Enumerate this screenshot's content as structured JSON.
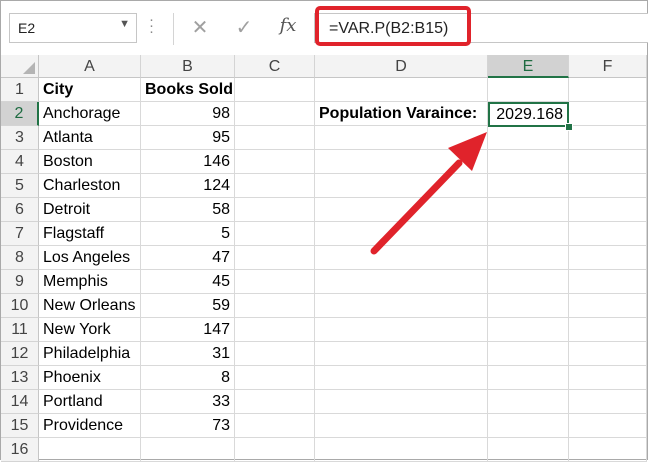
{
  "name_box": {
    "value": "E2"
  },
  "formula_bar": {
    "cancel_glyph": "✕",
    "enter_glyph": "✓",
    "fx_label": "fx",
    "formula": "=VAR.P(B2:B15)"
  },
  "columns": [
    "A",
    "B",
    "C",
    "D",
    "E",
    "F"
  ],
  "rows": [
    "1",
    "2",
    "3",
    "4",
    "5",
    "6",
    "7",
    "8",
    "9",
    "10",
    "11",
    "12",
    "13",
    "14",
    "15",
    "16"
  ],
  "headers": {
    "city": "City",
    "books_sold": "Books Sold"
  },
  "data": [
    {
      "city": "Anchorage",
      "books": "98"
    },
    {
      "city": "Atlanta",
      "books": "95"
    },
    {
      "city": "Boston",
      "books": "146"
    },
    {
      "city": "Charleston",
      "books": "124"
    },
    {
      "city": "Detroit",
      "books": "58"
    },
    {
      "city": "Flagstaff",
      "books": "5"
    },
    {
      "city": "Los Angeles",
      "books": "47"
    },
    {
      "city": "Memphis",
      "books": "45"
    },
    {
      "city": "New Orleans",
      "books": "59"
    },
    {
      "city": "New York",
      "books": "147"
    },
    {
      "city": "Philadelphia",
      "books": "31"
    },
    {
      "city": "Phoenix",
      "books": "8"
    },
    {
      "city": "Portland",
      "books": "33"
    },
    {
      "city": "Providence",
      "books": "73"
    }
  ],
  "label_cell": {
    "text": "Population Varaince:"
  },
  "result_cell": {
    "value": "2029.168"
  },
  "annotation": {
    "highlight_color": "#e0232b",
    "selection_color": "#217346"
  }
}
